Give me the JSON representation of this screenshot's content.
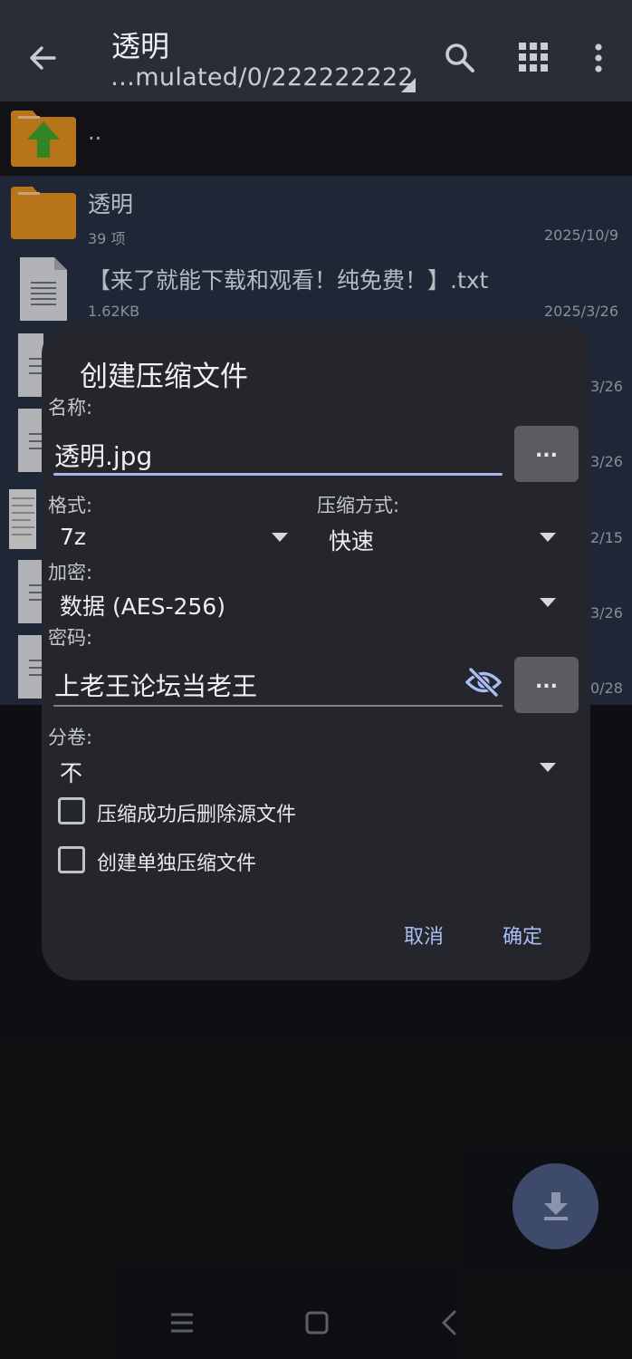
{
  "appbar": {
    "title": "透明",
    "path": "…mulated/0/222222222",
    "icons": [
      "arrow-back-icon",
      "search-icon",
      "grid-view-icon",
      "more-vertical-icon"
    ]
  },
  "file_list": {
    "parent_label": "..",
    "items": [
      {
        "name": "透明",
        "meta": "39 项",
        "date": "2025/10/9",
        "icon": "folder-icon"
      },
      {
        "name": "【来了就能下载和观看！纯免费！】.txt",
        "meta": "1.62KB",
        "date": "2025/3/26",
        "icon": "document-icon"
      }
    ],
    "peek_dates": [
      "3/26",
      "3/26",
      "2/15",
      "3/26",
      "0/28"
    ]
  },
  "dialog": {
    "title": "创建压缩文件",
    "name_label": "名称:",
    "name_value": "透明.jpg",
    "browse_label": "...",
    "format_label": "格式:",
    "format_value": "7z",
    "compression_label": "压缩方式:",
    "compression_value": "快速",
    "encryption_label": "加密:",
    "encryption_value": "数据 (AES-256)",
    "password_label": "密码:",
    "password_value": "上老王论坛当老王",
    "split_label": "分卷:",
    "split_value": "不",
    "checkbox_delete_source": "压缩成功后删除源文件",
    "checkbox_separate": "创建单独压缩文件",
    "cancel": "取消",
    "ok": "确定"
  },
  "colors": {
    "accent": "#a9bcf4",
    "appbar": "#2a2d36",
    "dialog": "#25262b",
    "list_selected": "#263044",
    "folder": "#e08e1f"
  }
}
